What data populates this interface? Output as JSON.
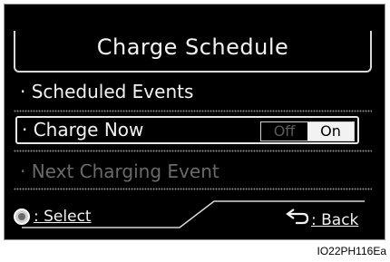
{
  "screen": {
    "title": "Charge Schedule",
    "items": [
      {
        "label": "· Scheduled Events",
        "enabled": true
      },
      {
        "label": "· Charge Now",
        "enabled": true,
        "toggle": {
          "off_label": "Off",
          "on_label": "On",
          "selected": "On"
        }
      },
      {
        "label": "· Next Charging Event",
        "enabled": false
      }
    ],
    "footer": {
      "select_label": ": Select",
      "back_label": ": Back"
    }
  },
  "caption": "IO22PH116Ea",
  "colors": {
    "background": "#000000",
    "text": "#f2f2f2",
    "disabled_text": "#6a6a6a",
    "accent": "#f2f2f2"
  },
  "icons": {
    "select": "select-knob-icon",
    "back": "back-arrow-icon"
  }
}
